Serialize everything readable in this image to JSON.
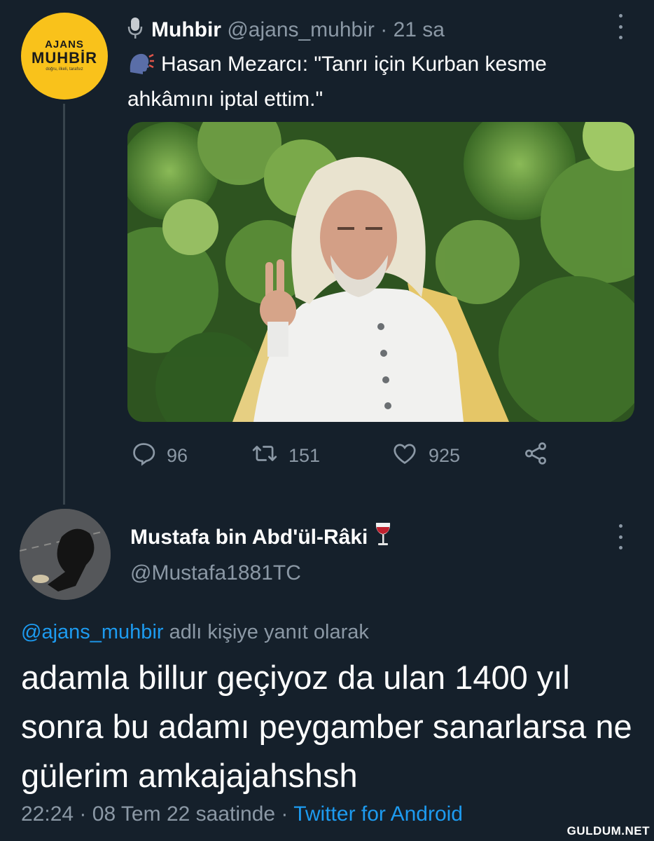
{
  "original_tweet": {
    "display_name": "Muhbir",
    "handle": "@ajans_muhbir",
    "separator": "·",
    "time_ago": "21 sa",
    "text_line1": "Hasan Mezarcı: \"Tanrı için Kurban kesme",
    "text_line2": "ahkâmını iptal ettim.\"",
    "avatar_logo": {
      "top": "AJANS",
      "main": "MUHBİR",
      "tagline": "doğru, ilkeli, tarafsız"
    },
    "actions": {
      "replies": "96",
      "retweets": "151",
      "likes": "925"
    }
  },
  "reply_tweet": {
    "display_name": "Mustafa bin Abd'ül-Râki",
    "handle": "@Mustafa1881TC",
    "replying_to_handle": "@ajans_muhbir",
    "replying_to_suffix": "adlı kişiye yanıt olarak",
    "text": "adamla billur geçiyoz da ulan 1400 yıl sonra bu adamı peygamber sanarlarsa ne gülerim amkajajahshsh",
    "time": "22:24",
    "date": "08 Tem 22 saatinde",
    "separator": "·",
    "source": "Twitter for Android"
  },
  "icons": [
    "microphone-icon",
    "speaking-head-icon",
    "reply-icon",
    "retweet-icon",
    "like-icon",
    "share-icon",
    "more-icon",
    "wine-glass-icon"
  ],
  "watermark": "GULDUM.NET",
  "colors": {
    "background": "#15202b",
    "muted": "#8b98a5",
    "link": "#1d9bf0",
    "logo_yellow": "#f9c21b"
  }
}
